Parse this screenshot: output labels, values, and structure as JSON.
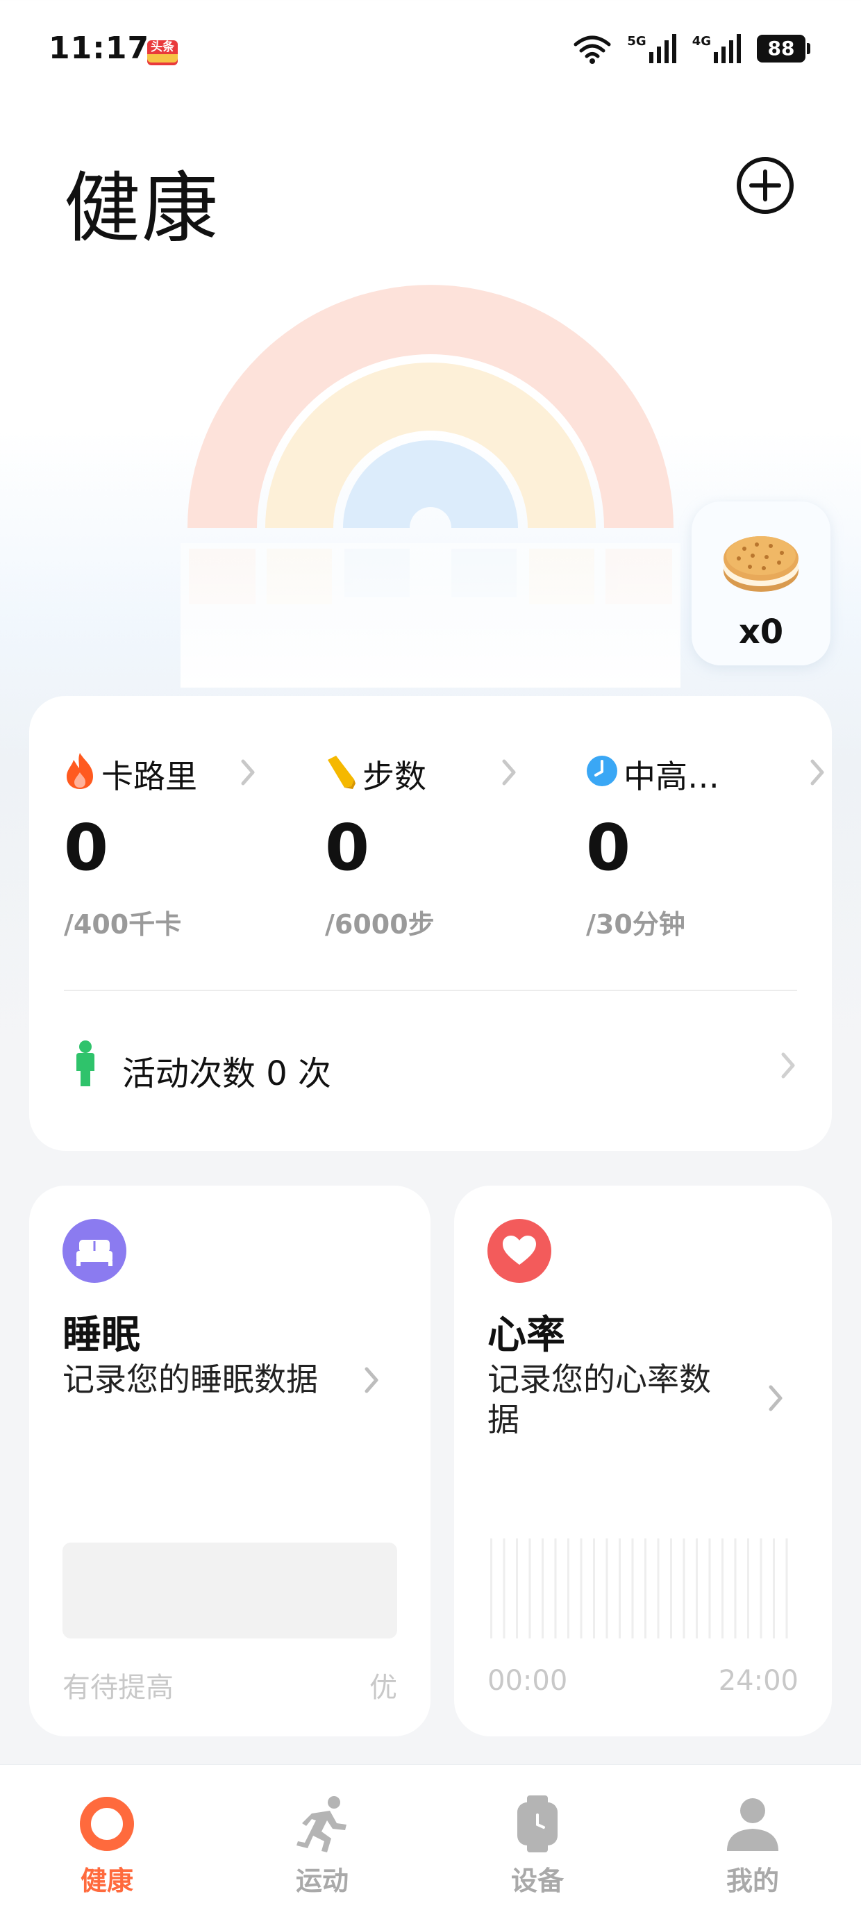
{
  "status_bar": {
    "time": "11:17",
    "news_app_badge": "头条",
    "network_5g": "5G",
    "network_4g": "4G",
    "battery": "88"
  },
  "header": {
    "title": "健康",
    "add_icon": "plus-circle-icon"
  },
  "rewards": {
    "icon": "cookie-icon",
    "count": "x0"
  },
  "activity": {
    "metrics": [
      {
        "icon": "flame-icon",
        "label": "卡路里",
        "value": "0",
        "goal": "/400千卡",
        "color": "#ff5a1f"
      },
      {
        "icon": "shoe-icon",
        "label": "步数",
        "value": "0",
        "goal": "/6000步",
        "color": "#f5b800"
      },
      {
        "icon": "clock-icon",
        "label": "中高…",
        "value": "0",
        "goal": "/30分钟",
        "color": "#3aa7f5"
      }
    ],
    "activity_count_label": "活动次数  0  次",
    "activity_icon": "person-standing-icon"
  },
  "sleep": {
    "icon": "bed-icon",
    "title": "睡眠",
    "subtitle": "记录您的睡眠数据",
    "footer_left": "有待提高",
    "footer_right": "优",
    "color": "#8b7bf0"
  },
  "heart_rate": {
    "icon": "heart-icon",
    "title": "心率",
    "subtitle": "记录您的心率数据",
    "footer_left": "00:00",
    "footer_right": "24:00",
    "color": "#f35b5b"
  },
  "tabs": [
    {
      "icon": "health-ring-icon",
      "label": "健康",
      "active": true
    },
    {
      "icon": "running-icon",
      "label": "运动",
      "active": false
    },
    {
      "icon": "watch-icon",
      "label": "设备",
      "active": false
    },
    {
      "icon": "profile-icon",
      "label": "我的",
      "active": false
    }
  ],
  "colors": {
    "accent": "#ff6a3d",
    "inactive_tab": "#a9a9a9",
    "ring_outer": "#fde2da",
    "ring_middle": "#fdf0d8",
    "ring_inner": "#dcecfb"
  }
}
